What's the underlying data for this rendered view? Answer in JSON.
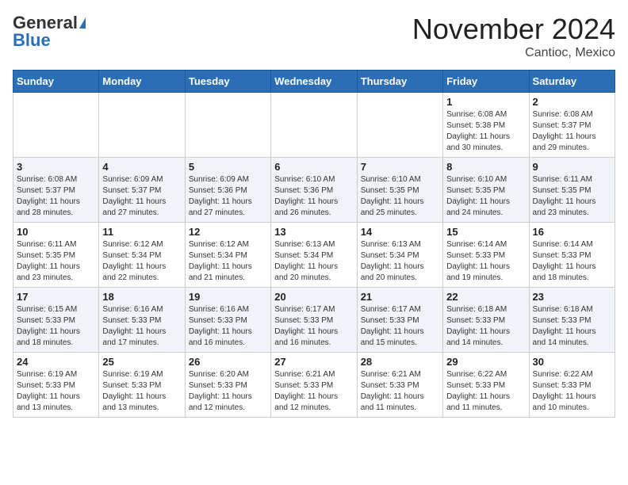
{
  "header": {
    "logo_line1": "General",
    "logo_line2": "Blue",
    "month_title": "November 2024",
    "location": "Cantioc, Mexico"
  },
  "weekdays": [
    "Sunday",
    "Monday",
    "Tuesday",
    "Wednesday",
    "Thursday",
    "Friday",
    "Saturday"
  ],
  "weeks": [
    [
      {
        "day": "",
        "info": ""
      },
      {
        "day": "",
        "info": ""
      },
      {
        "day": "",
        "info": ""
      },
      {
        "day": "",
        "info": ""
      },
      {
        "day": "",
        "info": ""
      },
      {
        "day": "1",
        "info": "Sunrise: 6:08 AM\nSunset: 5:38 PM\nDaylight: 11 hours\nand 30 minutes."
      },
      {
        "day": "2",
        "info": "Sunrise: 6:08 AM\nSunset: 5:37 PM\nDaylight: 11 hours\nand 29 minutes."
      }
    ],
    [
      {
        "day": "3",
        "info": "Sunrise: 6:08 AM\nSunset: 5:37 PM\nDaylight: 11 hours\nand 28 minutes."
      },
      {
        "day": "4",
        "info": "Sunrise: 6:09 AM\nSunset: 5:37 PM\nDaylight: 11 hours\nand 27 minutes."
      },
      {
        "day": "5",
        "info": "Sunrise: 6:09 AM\nSunset: 5:36 PM\nDaylight: 11 hours\nand 27 minutes."
      },
      {
        "day": "6",
        "info": "Sunrise: 6:10 AM\nSunset: 5:36 PM\nDaylight: 11 hours\nand 26 minutes."
      },
      {
        "day": "7",
        "info": "Sunrise: 6:10 AM\nSunset: 5:35 PM\nDaylight: 11 hours\nand 25 minutes."
      },
      {
        "day": "8",
        "info": "Sunrise: 6:10 AM\nSunset: 5:35 PM\nDaylight: 11 hours\nand 24 minutes."
      },
      {
        "day": "9",
        "info": "Sunrise: 6:11 AM\nSunset: 5:35 PM\nDaylight: 11 hours\nand 23 minutes."
      }
    ],
    [
      {
        "day": "10",
        "info": "Sunrise: 6:11 AM\nSunset: 5:35 PM\nDaylight: 11 hours\nand 23 minutes."
      },
      {
        "day": "11",
        "info": "Sunrise: 6:12 AM\nSunset: 5:34 PM\nDaylight: 11 hours\nand 22 minutes."
      },
      {
        "day": "12",
        "info": "Sunrise: 6:12 AM\nSunset: 5:34 PM\nDaylight: 11 hours\nand 21 minutes."
      },
      {
        "day": "13",
        "info": "Sunrise: 6:13 AM\nSunset: 5:34 PM\nDaylight: 11 hours\nand 20 minutes."
      },
      {
        "day": "14",
        "info": "Sunrise: 6:13 AM\nSunset: 5:34 PM\nDaylight: 11 hours\nand 20 minutes."
      },
      {
        "day": "15",
        "info": "Sunrise: 6:14 AM\nSunset: 5:33 PM\nDaylight: 11 hours\nand 19 minutes."
      },
      {
        "day": "16",
        "info": "Sunrise: 6:14 AM\nSunset: 5:33 PM\nDaylight: 11 hours\nand 18 minutes."
      }
    ],
    [
      {
        "day": "17",
        "info": "Sunrise: 6:15 AM\nSunset: 5:33 PM\nDaylight: 11 hours\nand 18 minutes."
      },
      {
        "day": "18",
        "info": "Sunrise: 6:16 AM\nSunset: 5:33 PM\nDaylight: 11 hours\nand 17 minutes."
      },
      {
        "day": "19",
        "info": "Sunrise: 6:16 AM\nSunset: 5:33 PM\nDaylight: 11 hours\nand 16 minutes."
      },
      {
        "day": "20",
        "info": "Sunrise: 6:17 AM\nSunset: 5:33 PM\nDaylight: 11 hours\nand 16 minutes."
      },
      {
        "day": "21",
        "info": "Sunrise: 6:17 AM\nSunset: 5:33 PM\nDaylight: 11 hours\nand 15 minutes."
      },
      {
        "day": "22",
        "info": "Sunrise: 6:18 AM\nSunset: 5:33 PM\nDaylight: 11 hours\nand 14 minutes."
      },
      {
        "day": "23",
        "info": "Sunrise: 6:18 AM\nSunset: 5:33 PM\nDaylight: 11 hours\nand 14 minutes."
      }
    ],
    [
      {
        "day": "24",
        "info": "Sunrise: 6:19 AM\nSunset: 5:33 PM\nDaylight: 11 hours\nand 13 minutes."
      },
      {
        "day": "25",
        "info": "Sunrise: 6:19 AM\nSunset: 5:33 PM\nDaylight: 11 hours\nand 13 minutes."
      },
      {
        "day": "26",
        "info": "Sunrise: 6:20 AM\nSunset: 5:33 PM\nDaylight: 11 hours\nand 12 minutes."
      },
      {
        "day": "27",
        "info": "Sunrise: 6:21 AM\nSunset: 5:33 PM\nDaylight: 11 hours\nand 12 minutes."
      },
      {
        "day": "28",
        "info": "Sunrise: 6:21 AM\nSunset: 5:33 PM\nDaylight: 11 hours\nand 11 minutes."
      },
      {
        "day": "29",
        "info": "Sunrise: 6:22 AM\nSunset: 5:33 PM\nDaylight: 11 hours\nand 11 minutes."
      },
      {
        "day": "30",
        "info": "Sunrise: 6:22 AM\nSunset: 5:33 PM\nDaylight: 11 hours\nand 10 minutes."
      }
    ]
  ]
}
